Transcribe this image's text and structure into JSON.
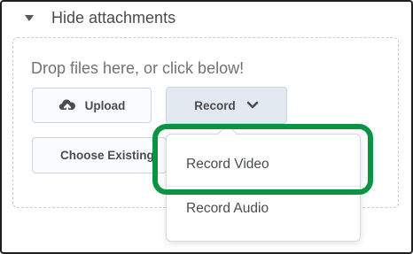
{
  "attachments": {
    "toggle_label": "Hide attachments"
  },
  "dropzone": {
    "prompt": "Drop files here, or click below!",
    "buttons": {
      "upload": "Upload",
      "record": "Record",
      "choose_existing": "Choose Existing"
    }
  },
  "record_menu": {
    "items": [
      {
        "label": "Record Video"
      },
      {
        "label": "Record Audio"
      }
    ]
  },
  "colors": {
    "highlight": "#0a9342",
    "button_bg": "#f9fbff",
    "record_active_bg": "#e3e9f1"
  },
  "icons": {
    "caret": "caret-down-icon",
    "upload": "cloud-upload-icon",
    "record_chevron": "chevron-down-icon"
  }
}
